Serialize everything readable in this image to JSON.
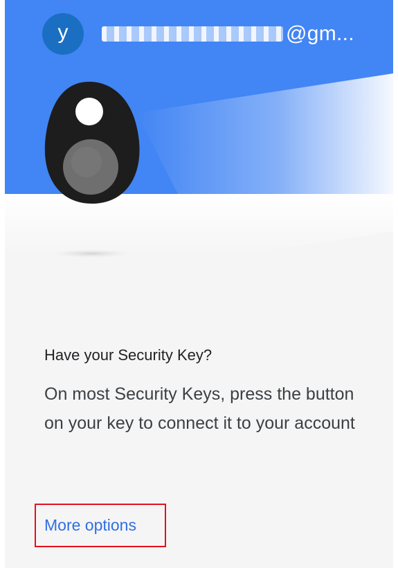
{
  "header": {
    "avatar_initial": "y",
    "email_visible_suffix": "@gm..."
  },
  "illustration": {
    "icon": "security-key-icon"
  },
  "prompt": {
    "title": "Have your Security Key?",
    "body": "On most Security Keys, press the button on your key to connect it to your account"
  },
  "actions": {
    "more_options_label": "More options"
  },
  "colors": {
    "header_blue": "#4285f4",
    "avatar_blue": "#1a6fc2",
    "link_blue": "#2f6fe4",
    "highlight_red": "#e0121c"
  }
}
